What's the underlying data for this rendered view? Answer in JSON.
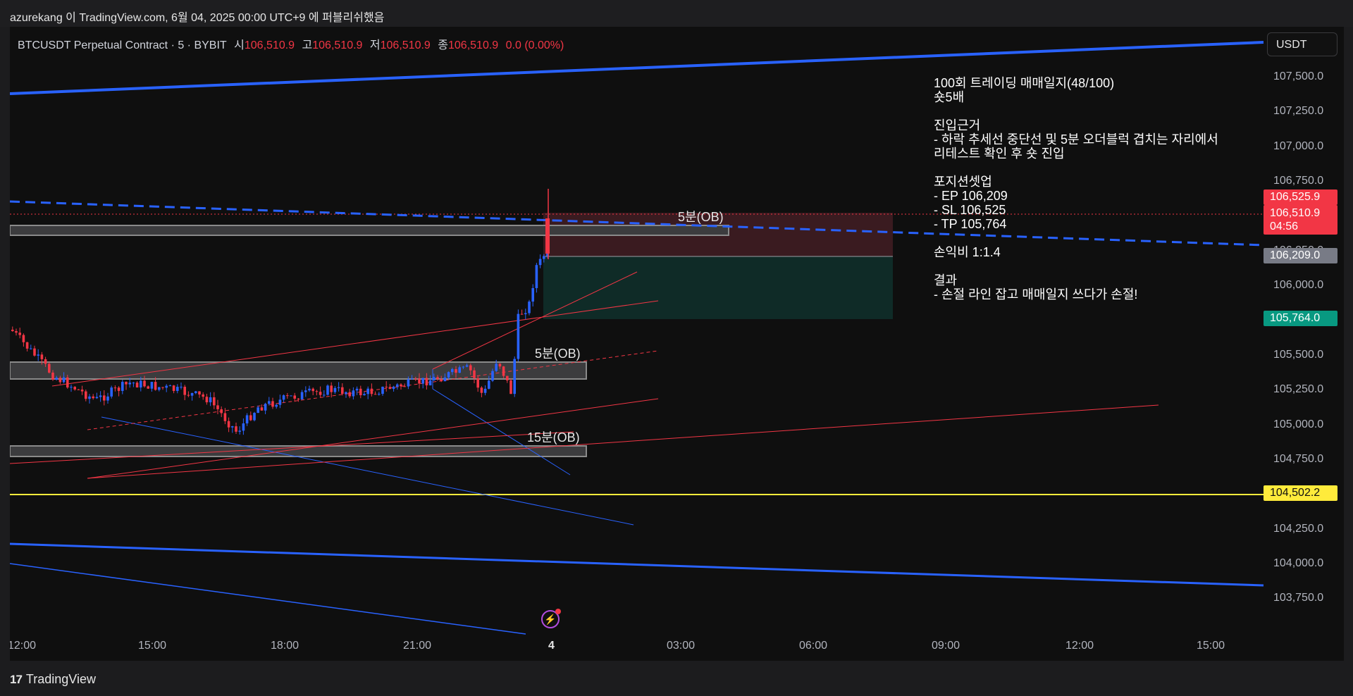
{
  "header": {
    "publish_text": "azurekang 이 TradingView.com, 6월 04, 2025 00:00 UTC+9 에 퍼블리쉬했음"
  },
  "symbol": {
    "title": "BTCUSDT Perpetual Contract · 5 · BYBIT",
    "open_label": "시",
    "open": "106,510.9",
    "high_label": "고",
    "high": "106,510.9",
    "low_label": "저",
    "low": "106,510.9",
    "close_label": "종",
    "close": "106,510.9",
    "change": "0.0 (0.00%)"
  },
  "currency": "USDT",
  "price_axis": [
    "107,500.0",
    "107,250.0",
    "107,000.0",
    "106,750.0",
    "106,250.0",
    "106,000.0",
    "105,500.0",
    "105,250.0",
    "105,000.0",
    "104,750.0",
    "104,250.0",
    "104,000.0",
    "103,750.0"
  ],
  "time_axis": [
    "12:00",
    "15:00",
    "18:00",
    "21:00",
    "4",
    "03:00",
    "06:00",
    "09:00",
    "12:00",
    "15:00"
  ],
  "badges": {
    "sl": {
      "price": "106,525.9",
      "color": "#f23645"
    },
    "last": {
      "price": "106,510.9",
      "countdown": "04:56",
      "color": "#f23645"
    },
    "ep": {
      "price": "106,209.0",
      "color": "#787b86"
    },
    "tp": {
      "price": "105,764.0",
      "color": "#089981"
    },
    "yellow": {
      "price": "104,502.2",
      "color": "#ffeb3b"
    }
  },
  "ob_labels": {
    "a": "5분(OB)",
    "b": "5분(OB)",
    "c": "15분(OB)"
  },
  "note": {
    "title": "100회 트레이딩 매매일지(48/100)",
    "position": "숏5배",
    "entry_heading": "진입근거",
    "entry_1": "- 하락 추세선 중단선 및 5분 오더블럭 겹치는 자리에서",
    "entry_2": "리테스트 확인 후 숏 진입",
    "setup_heading": "포지션셋업",
    "ep": "- EP 106,209",
    "sl": "- SL 106,525",
    "tp": "- TP 105,764",
    "rr": "손익비 1:1.4",
    "result_heading": "결과",
    "result": "- 손절 라인 잡고 매매일지 쓰다가 손절!"
  },
  "footer": {
    "brand": "TradingView"
  },
  "colors": {
    "up": "#2962ff",
    "down": "#f23645",
    "trend_blue": "#2962ff",
    "yellow": "#ffeb3b"
  }
}
